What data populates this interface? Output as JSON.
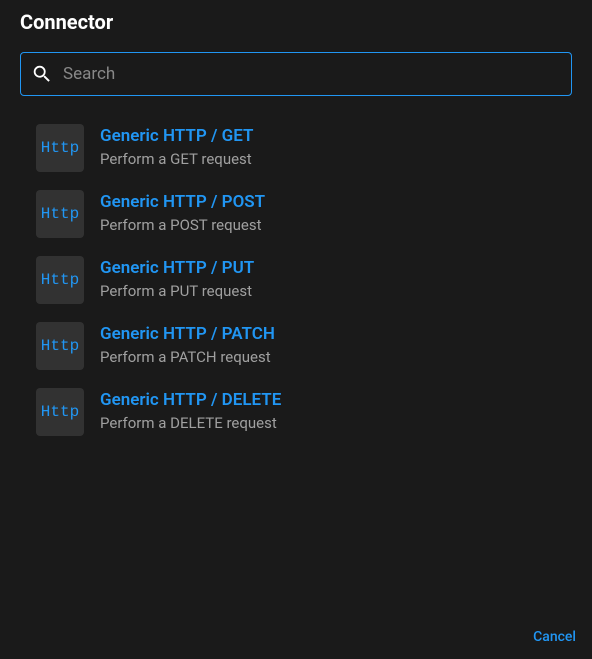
{
  "header": {
    "title": "Connector"
  },
  "search": {
    "placeholder": "Search",
    "value": ""
  },
  "connectors": [
    {
      "icon_label": "Http",
      "title": "Generic HTTP / GET",
      "description": "Perform a GET request"
    },
    {
      "icon_label": "Http",
      "title": "Generic HTTP / POST",
      "description": "Perform a POST request"
    },
    {
      "icon_label": "Http",
      "title": "Generic HTTP / PUT",
      "description": "Perform a PUT request"
    },
    {
      "icon_label": "Http",
      "title": "Generic HTTP / PATCH",
      "description": "Perform a PATCH request"
    },
    {
      "icon_label": "Http",
      "title": "Generic HTTP / DELETE",
      "description": "Perform a DELETE request"
    }
  ],
  "footer": {
    "cancel_label": "Cancel"
  }
}
